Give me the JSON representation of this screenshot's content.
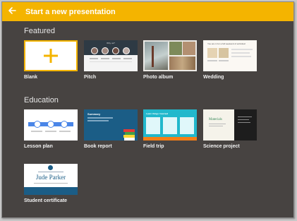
{
  "header": {
    "title": "Start a new presentation"
  },
  "sections": {
    "featured": {
      "title": "Featured",
      "templates": [
        "Blank",
        "Pitch",
        "Photo album",
        "Wedding"
      ]
    },
    "education": {
      "title": "Education",
      "templates": [
        "Lesson plan",
        "Book report",
        "Field trip",
        "Science project",
        "Student certificate"
      ]
    }
  },
  "thumbs": {
    "pitch": {
      "heading": "Why us?"
    },
    "wedding": {
      "heading": "You are in for a full weekend of activities!"
    },
    "book_report": {
      "heading": "Summary"
    },
    "field_trip": {
      "heading": "Learn things I learned"
    },
    "science": {
      "heading": "Materials"
    },
    "certificate": {
      "name": "Jude Parker"
    }
  },
  "colors": {
    "accent": "#f4b400",
    "background": "#474341",
    "book_report_blue": "#1b5d86",
    "field_trip_teal": "#22b8cc"
  }
}
